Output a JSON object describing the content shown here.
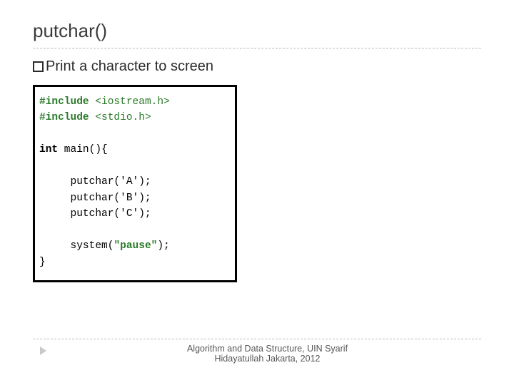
{
  "title": "putchar()",
  "subtitle": {
    "word1": "Print",
    "rest": "a character to screen"
  },
  "code": {
    "inc1_kw": "#include",
    "inc1_hdr": "<iostream.h>",
    "inc2_kw": "#include",
    "inc2_hdr": "<stdio.h>",
    "int_kw": "int",
    "main_sig": " main(){",
    "l1": "putchar('A');",
    "l2": "putchar('B');",
    "l3": "putchar('C');",
    "sys_call": "system(",
    "sys_arg": "\"pause\"",
    "sys_end": ");",
    "close": "}"
  },
  "footer": {
    "line1": "Algorithm and Data Structure, UIN Syarif",
    "line2": "Hidayatullah Jakarta, 2012"
  }
}
